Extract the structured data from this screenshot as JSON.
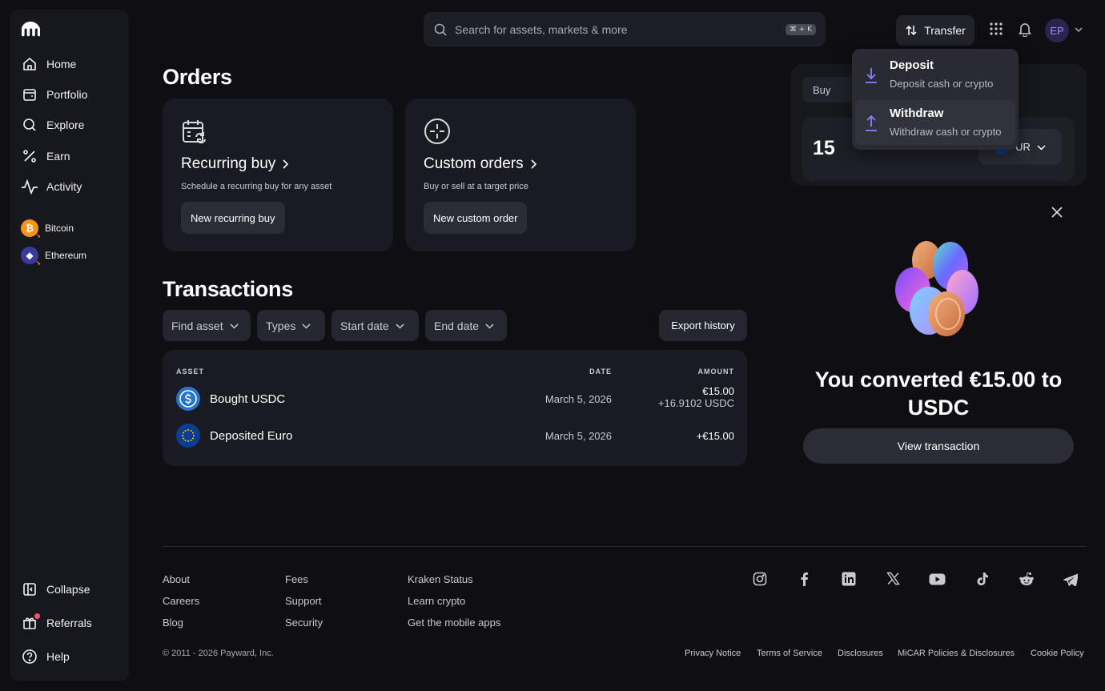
{
  "sidebar": {
    "nav": [
      {
        "label": "Home",
        "icon": "home-icon"
      },
      {
        "label": "Portfolio",
        "icon": "portfolio-icon"
      },
      {
        "label": "Explore",
        "icon": "search-icon"
      },
      {
        "label": "Earn",
        "icon": "percent-icon"
      },
      {
        "label": "Activity",
        "icon": "activity-icon"
      }
    ],
    "assets": [
      {
        "label": "Bitcoin",
        "symbol": "₿",
        "color": "#f7931a"
      },
      {
        "label": "Ethereum",
        "symbol": "◆",
        "color": "#3a3a9a"
      }
    ],
    "bottom": [
      {
        "label": "Collapse",
        "icon": "collapse-icon"
      },
      {
        "label": "Referrals",
        "icon": "gift-icon"
      },
      {
        "label": "Help",
        "icon": "help-icon"
      }
    ]
  },
  "header": {
    "search_placeholder": "Search for assets, markets & more",
    "search_shortcut": "⌘ + K",
    "transfer_label": "Transfer",
    "avatar_initials": "EP"
  },
  "transfer_menu": [
    {
      "title": "Deposit",
      "subtitle": "Deposit cash or crypto"
    },
    {
      "title": "Withdraw",
      "subtitle": "Withdraw cash or crypto"
    }
  ],
  "orders": {
    "title": "Orders",
    "cards": [
      {
        "title": "Recurring buy",
        "subtitle": "Schedule a recurring buy for any asset",
        "button": "New recurring buy"
      },
      {
        "title": "Custom orders",
        "subtitle": "Buy or sell at a target price",
        "button": "New custom order"
      }
    ]
  },
  "transactions": {
    "title": "Transactions",
    "filters": [
      "Find asset",
      "Types",
      "Start date",
      "End date"
    ],
    "export_label": "Export history",
    "columns": [
      "ASSET",
      "DATE",
      "AMOUNT"
    ],
    "rows": [
      {
        "name": "Bought USDC",
        "date": "March 5, 2026",
        "amount": "€15.00",
        "amount2": "+16.9102 USDC"
      },
      {
        "name": "Deposited Euro",
        "date": "March 5, 2026",
        "amount": "+€15.00",
        "amount2": ""
      }
    ]
  },
  "buy_panel": {
    "tab": "Buy",
    "amount": "15",
    "currency": "UR"
  },
  "success": {
    "title": "You converted €15.00 to USDC",
    "button": "View transaction"
  },
  "footer": {
    "col1": [
      "About",
      "Careers",
      "Blog"
    ],
    "col2": [
      "Fees",
      "Support",
      "Security"
    ],
    "col3": [
      "Kraken Status",
      "Learn crypto",
      "Get the mobile apps"
    ],
    "social": [
      "instagram-icon",
      "facebook-icon",
      "linkedin-icon",
      "x-icon",
      "youtube-icon",
      "tiktok-icon",
      "reddit-icon",
      "telegram-icon"
    ],
    "copyright": "© 2011 - 2026 Payward, Inc.",
    "legal": [
      "Privacy Notice",
      "Terms of Service",
      "Disclosures",
      "MiCAR Policies & Disclosures",
      "Cookie Policy"
    ]
  }
}
